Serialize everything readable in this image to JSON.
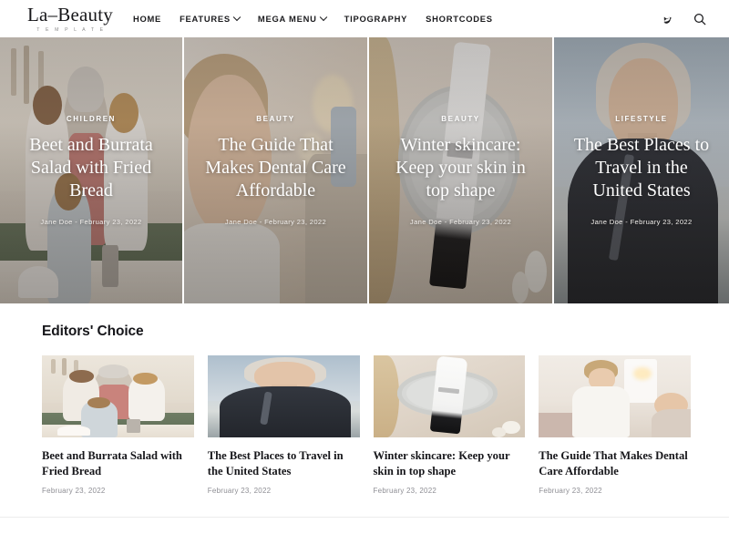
{
  "header": {
    "brand_name": "La–Beauty",
    "brand_sub": "T E M P L A T E",
    "nav": [
      {
        "label": "HOME",
        "has_caret": false
      },
      {
        "label": "FEATURES",
        "has_caret": true
      },
      {
        "label": "MEGA MENU",
        "has_caret": true
      },
      {
        "label": "TIPOGRAPHY",
        "has_caret": false
      },
      {
        "label": "SHORTCODES",
        "has_caret": false
      }
    ],
    "actions": [
      {
        "icon": "bird-icon"
      },
      {
        "icon": "search-icon"
      }
    ]
  },
  "hero": {
    "cards": [
      {
        "category": "CHILDREN",
        "title": "Beet and Burrata Salad with Fried Bread",
        "author": "Jane Doe",
        "separator": "-",
        "date": "February 23, 2022"
      },
      {
        "category": "BEAUTY",
        "title": "The Guide That Makes Dental Care Affordable",
        "author": "Jane Doe",
        "separator": "-",
        "date": "February 23, 2022"
      },
      {
        "category": "BEAUTY",
        "title": "Winter skincare: Keep your skin in top shape",
        "author": "Jane Doe",
        "separator": "-",
        "date": "February 23, 2022"
      },
      {
        "category": "LIFESTYLE",
        "title": "The Best Places to Travel in the United States",
        "author": "Jane Doe",
        "separator": "-",
        "date": "February 23, 2022"
      }
    ]
  },
  "editors_choice": {
    "title": "Editors' Choice",
    "posts": [
      {
        "title": "Beet and Burrata Salad with Fried Bread",
        "date": "February 23, 2022"
      },
      {
        "title": "The Best Places to Travel in the United States",
        "date": "February 23, 2022"
      },
      {
        "title": "Winter skincare: Keep your skin in top shape",
        "date": "February 23, 2022"
      },
      {
        "title": "The Guide That Makes Dental Care Affordable",
        "date": "February 23, 2022"
      }
    ]
  },
  "colors": {
    "text": "#16161a",
    "muted": "#8e8e94",
    "background": "#ffffff",
    "overlay_text": "#ffffff"
  }
}
